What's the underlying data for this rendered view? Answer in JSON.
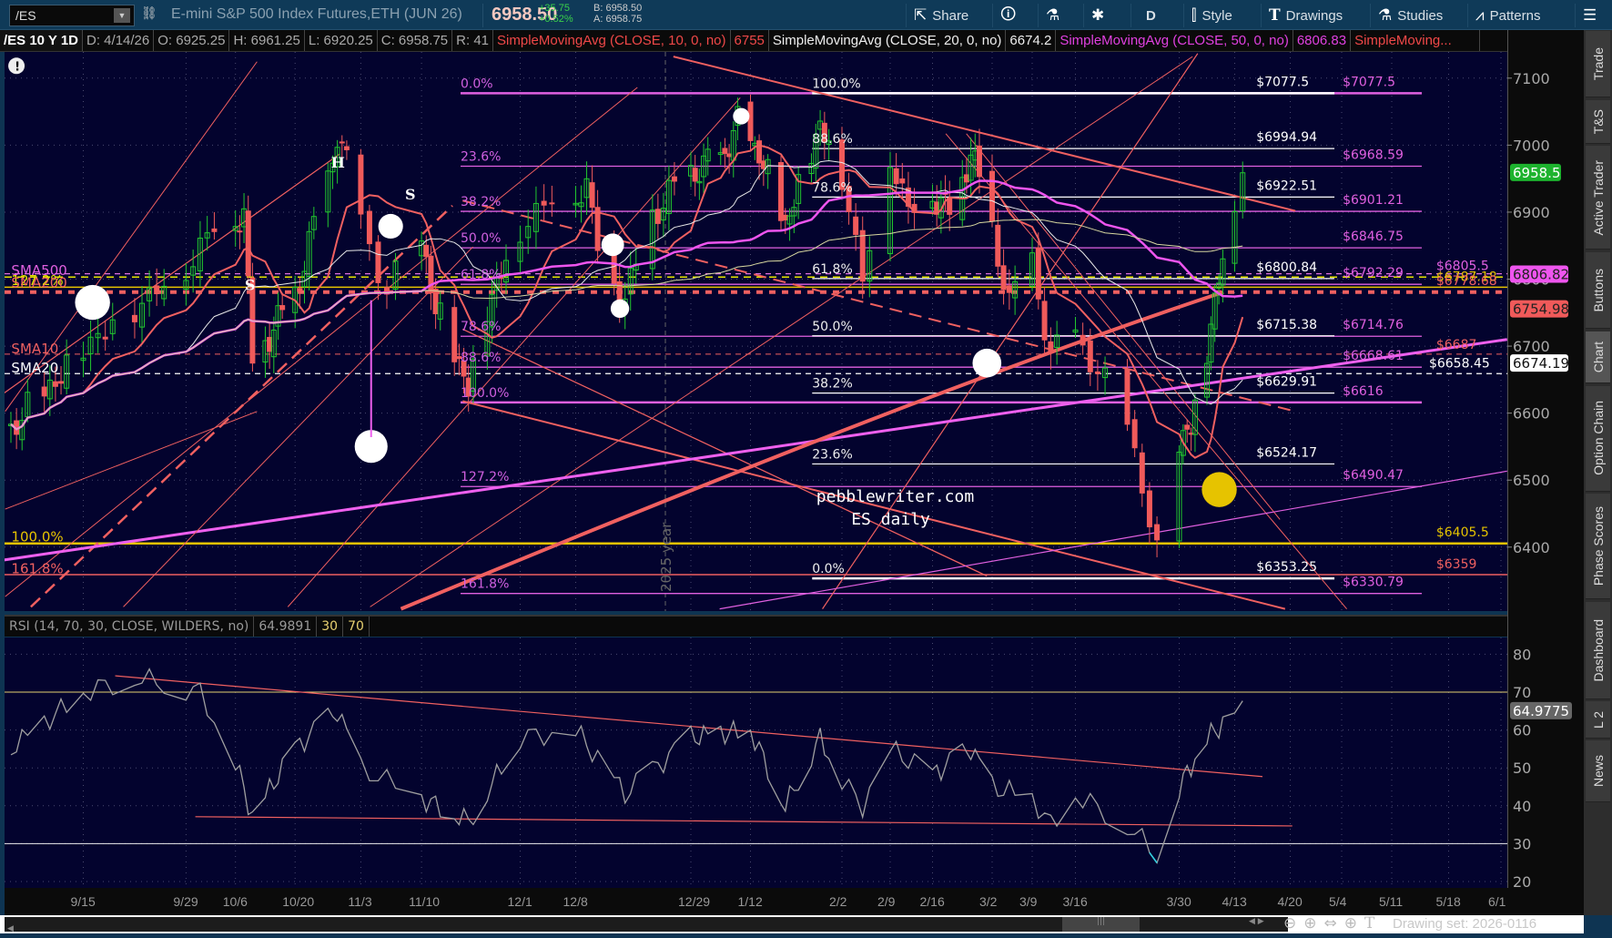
{
  "toolbar": {
    "symbol": "/ES",
    "description": "E-mini S&P 500 Index Futures,ETH (JUN 26)",
    "last": "6958.50",
    "change": "+35.75",
    "change_pct": "+0.52%",
    "bid": "B: 6958.50",
    "ask": "A: 6958.75",
    "share": "Share",
    "aggregation": "D",
    "style": "Style",
    "drawings": "Drawings",
    "studies": "Studies",
    "patterns": "Patterns"
  },
  "infobar": {
    "title": "/ES 10 Y 1D",
    "date": "D: 4/14/26",
    "open": "O: 6925.25",
    "high": "H: 6961.25",
    "low": "L: 6920.25",
    "close": "C: 6958.75",
    "range": "R: 41",
    "sma10_label": "SimpleMovingAvg (CLOSE, 10, 0, no)",
    "sma10_value": "6755",
    "sma20_label": "SimpleMovingAvg (CLOSE, 20, 0, no)",
    "sma20_value": "6674.2",
    "sma50_label": "SimpleMovingAvg (CLOSE, 50, 0, no)",
    "sma50_value": "6806.83",
    "more_label": "SimpleMoving..."
  },
  "colors": {
    "up": "#22c72e",
    "down": "#f05a5a",
    "sma50": "#ee55ee",
    "sma10": "#f06060",
    "fib_pink": "#e060e0",
    "yellow": "#e6c300",
    "bg": "#03032e"
  },
  "price_axis": {
    "ticks": [
      "7100",
      "7000",
      "6900",
      "6800",
      "6700",
      "6600",
      "6500",
      "6400"
    ],
    "badges": {
      "last": "6958.5",
      "sma50": "6806.82",
      "sma10": "6754.98",
      "sma20": "6674.19"
    }
  },
  "rsi": {
    "header": "RSI (14, 70, 30, CLOSE, WILDERS, no)",
    "value": "64.9891",
    "oversold": "30",
    "overbought": "70",
    "badge": "64.9775",
    "ticks": [
      "80",
      "70",
      "60",
      "50",
      "40",
      "30",
      "20"
    ]
  },
  "annotations": {
    "watermark1": "pebblewriter.com",
    "watermark2": "ES daily",
    "year_marker": "2025 year",
    "h": "H",
    "s1": "S",
    "s2": "S",
    "left_labels": [
      "SMA500",
      "127.2%",
      "SMA200",
      "SMA10",
      "SMA20",
      "100.0%",
      "161.8%"
    ],
    "fib_a_pcts": [
      "0.0%",
      "23.6%",
      "38.2%",
      "50.0%",
      "61.8%",
      "78.6%",
      "88.6%",
      "100.0%",
      "127.2%",
      "161.8%"
    ],
    "fib_a_prices": [
      "$7077.5",
      "$6968.59",
      "$6901.21",
      "$6846.75",
      "$6792.29",
      "$6714.76",
      "$6668.61",
      "$6616",
      "$6490.47",
      "$6330.79"
    ],
    "fib_b_pcts": [
      "100.0%",
      "88.6%",
      "78.6%",
      "61.8%",
      "50.0%",
      "38.2%",
      "23.6%",
      "0.0%"
    ],
    "fib_b_prices": [
      "$7077.5",
      "$6994.94",
      "$6922.51",
      "$6800.84",
      "$6715.38",
      "$6629.91",
      "$6524.17",
      "$6353.25"
    ],
    "right_labels": [
      "$6805.5",
      "$6787.18",
      "$6778.68",
      "$6687",
      "$6658.45",
      "$6405.5",
      "$6359"
    ]
  },
  "chart_data": {
    "type": "candlestick",
    "symbol": "/ES",
    "ylim": [
      6290,
      7140
    ],
    "fib_a_levels": [
      7077.5,
      6968.59,
      6901.21,
      6846.75,
      6792.29,
      6714.76,
      6668.61,
      6616,
      6490.47,
      6330.79
    ],
    "fib_b_levels": [
      7077.5,
      6994.94,
      6922.51,
      6800.84,
      6715.38,
      6629.91,
      6524.17,
      6353.25
    ],
    "horizontal_levels": {
      "sma500": 6808,
      "sma200_y": 6803,
      "yellow_100": 6788,
      "red_dotted": 6780.7,
      "sma10": 6688,
      "sma20": 6659,
      "yellow_6405": 6405.5,
      "red_6359": 6359
    },
    "x_ticks": [
      {
        "label": "9/15",
        "date": "2025-09-15"
      },
      {
        "label": "9/29",
        "date": "2025-09-29"
      },
      {
        "label": "10/6",
        "date": "2025-10-06"
      },
      {
        "label": "10/20",
        "date": "2025-10-20"
      },
      {
        "label": "11/3",
        "date": "2025-11-03"
      },
      {
        "label": "11/10",
        "date": "2025-11-10"
      },
      {
        "label": "12/1",
        "date": "2025-12-01"
      },
      {
        "label": "12/8",
        "date": "2025-12-08"
      },
      {
        "label": "12/29",
        "date": "2025-12-29"
      },
      {
        "label": "1/12",
        "date": "2026-01-12"
      },
      {
        "label": "2/2",
        "date": "2026-02-02"
      },
      {
        "label": "2/9",
        "date": "2026-02-09"
      },
      {
        "label": "2/16",
        "date": "2026-02-16"
      },
      {
        "label": "3/2",
        "date": "2026-03-02"
      },
      {
        "label": "3/9",
        "date": "2026-03-09"
      },
      {
        "label": "3/16",
        "date": "2026-03-16"
      },
      {
        "label": "3/30",
        "date": "2026-03-30"
      },
      {
        "label": "4/13",
        "date": "2026-04-13"
      },
      {
        "label": "4/20",
        "date": "2026-04-20"
      },
      {
        "label": "5/4",
        "date": "2026-05-04"
      },
      {
        "label": "5/11",
        "date": "2026-05-11"
      },
      {
        "label": "5/18",
        "date": "2026-05-18"
      },
      {
        "label": "6/1",
        "date": "2026-06-01"
      }
    ],
    "close_anchors": [
      [
        "2025-09-02",
        6580
      ],
      [
        "2025-09-10",
        6650
      ],
      [
        "2025-09-15",
        6700
      ],
      [
        "2025-09-22",
        6760
      ],
      [
        "2025-09-29",
        6820
      ],
      [
        "2025-10-03",
        6880
      ],
      [
        "2025-10-08",
        6900
      ],
      [
        "2025-10-10",
        6680
      ],
      [
        "2025-10-14",
        6720
      ],
      [
        "2025-10-20",
        6780
      ],
      [
        "2025-10-27",
        6950
      ],
      [
        "2025-10-29",
        7020
      ],
      [
        "2025-11-03",
        6890
      ],
      [
        "2025-11-06",
        6780
      ],
      [
        "2025-11-10",
        6860
      ],
      [
        "2025-11-13",
        6760
      ],
      [
        "2025-11-20",
        6640
      ],
      [
        "2025-11-24",
        6760
      ],
      [
        "2025-12-01",
        6880
      ],
      [
        "2025-12-05",
        6920
      ],
      [
        "2025-12-10",
        6940
      ],
      [
        "2025-12-12",
        6850
      ],
      [
        "2025-12-17",
        6770
      ],
      [
        "2025-12-22",
        6900
      ],
      [
        "2025-12-29",
        6960
      ],
      [
        "2026-01-05",
        6980
      ],
      [
        "2026-01-09",
        7030
      ],
      [
        "2026-01-14",
        6990
      ],
      [
        "2026-01-20",
        6880
      ],
      [
        "2026-01-23",
        6940
      ],
      [
        "2026-01-28",
        7030
      ],
      [
        "2026-02-02",
        6960
      ],
      [
        "2026-02-05",
        6800
      ],
      [
        "2026-02-09",
        6990
      ],
      [
        "2026-02-12",
        6900
      ],
      [
        "2026-02-16",
        6930
      ],
      [
        "2026-02-20",
        6900
      ],
      [
        "2026-02-25",
        6990
      ],
      [
        "2026-03-02",
        6880
      ],
      [
        "2026-03-05",
        6760
      ],
      [
        "2026-03-09",
        6830
      ],
      [
        "2026-03-12",
        6680
      ],
      [
        "2026-03-16",
        6720
      ],
      [
        "2026-03-20",
        6640
      ],
      [
        "2026-03-23",
        6590
      ],
      [
        "2026-03-27",
        6390
      ],
      [
        "2026-03-30",
        6560
      ],
      [
        "2026-04-02",
        6580
      ],
      [
        "2026-04-06",
        6700
      ],
      [
        "2026-04-09",
        6800
      ],
      [
        "2026-04-14",
        6958.75
      ]
    ],
    "rsi_anchors": [
      [
        "2025-09-02",
        55
      ],
      [
        "2025-09-15",
        70
      ],
      [
        "2025-09-22",
        74
      ],
      [
        "2025-10-01",
        70
      ],
      [
        "2025-10-10",
        37
      ],
      [
        "2025-10-20",
        55
      ],
      [
        "2025-10-29",
        65
      ],
      [
        "2025-11-03",
        50
      ],
      [
        "2025-11-10",
        42
      ],
      [
        "2025-11-20",
        36
      ],
      [
        "2025-12-01",
        58
      ],
      [
        "2025-12-08",
        60
      ],
      [
        "2025-12-17",
        43
      ],
      [
        "2025-12-29",
        58
      ],
      [
        "2026-01-12",
        60
      ],
      [
        "2026-01-20",
        40
      ],
      [
        "2026-01-28",
        58
      ],
      [
        "2026-02-05",
        40
      ],
      [
        "2026-02-09",
        55
      ],
      [
        "2026-02-16",
        48
      ],
      [
        "2026-02-25",
        55
      ],
      [
        "2026-03-02",
        45
      ],
      [
        "2026-03-09",
        42
      ],
      [
        "2026-03-12",
        35
      ],
      [
        "2026-03-16",
        43
      ],
      [
        "2026-03-23",
        35
      ],
      [
        "2026-03-27",
        27
      ],
      [
        "2026-03-30",
        45
      ],
      [
        "2026-04-06",
        58
      ],
      [
        "2026-04-14",
        65
      ]
    ]
  },
  "sidebar_tabs": [
    "Trade",
    "T&S",
    "Active Trader",
    "Buttons",
    "Chart",
    "Option Chain",
    "Phase Scores",
    "Dashboard",
    "L 2",
    "News"
  ],
  "footer": {
    "drawing_set": "Drawing set: 2026-0116"
  }
}
